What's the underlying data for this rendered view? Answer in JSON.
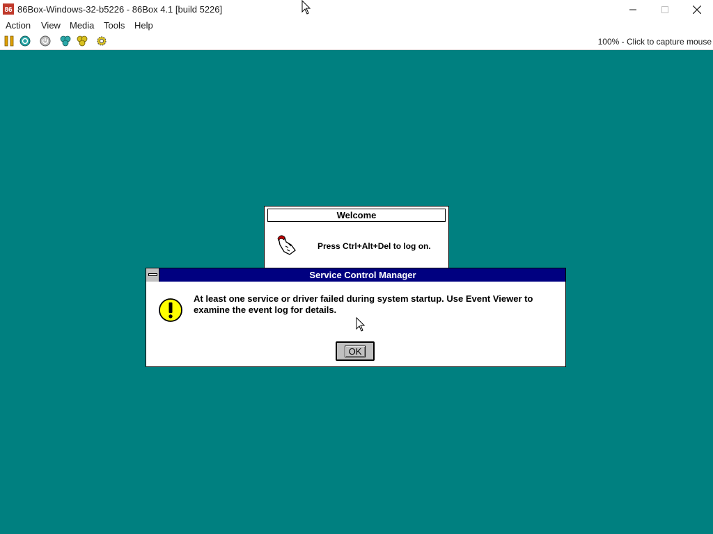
{
  "host_window": {
    "title": "86Box-Windows-32-b5226 - 86Box 4.1 [build 5226]",
    "icon": "86box-app-icon",
    "controls": [
      "minimize-icon",
      "maximize-icon",
      "close-icon"
    ]
  },
  "menubar": {
    "items": [
      {
        "label": "Action"
      },
      {
        "label": "View"
      },
      {
        "label": "Media"
      },
      {
        "label": "Tools"
      },
      {
        "label": "Help"
      }
    ]
  },
  "toolbar": {
    "buttons": [
      "pause-icon",
      "hard-reset-icon",
      "acpi-shutdown-icon",
      "ctrl-alt-del-icon",
      "ctrl-alt-esc-icon",
      "settings-icon"
    ],
    "status": "100% - Click to capture mouse"
  },
  "guest": {
    "desktop_color": "#008080",
    "welcome": {
      "title": "Welcome",
      "message": "Press Ctrl+Alt+Del to log on.",
      "icon": "hand-keyboard-icon"
    },
    "dialog": {
      "title": "Service Control Manager",
      "message": "At least one service or driver failed during system startup.  Use Event Viewer to examine the event log for details.",
      "icon": "exclamation-icon",
      "ok_label": "OK",
      "titlebar_color": "#000080"
    }
  }
}
